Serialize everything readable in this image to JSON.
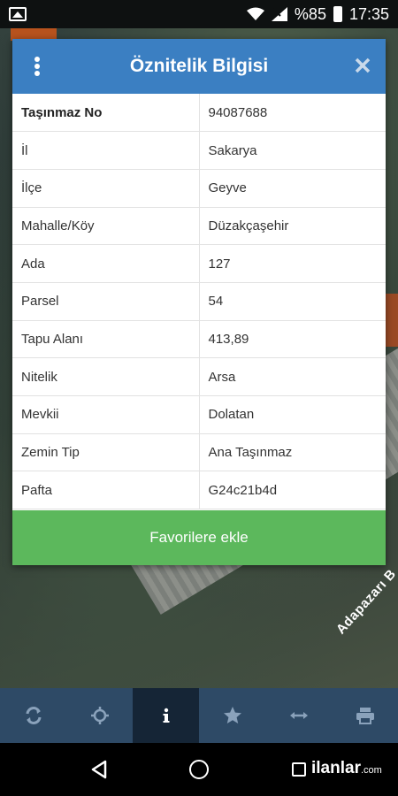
{
  "status_bar": {
    "battery": "%85",
    "time": "17:35"
  },
  "map": {
    "road_label": "Adapazarı B"
  },
  "dialog": {
    "title": "Öznitelik Bilgisi",
    "rows": [
      {
        "key": "Taşınmaz No",
        "value": "94087688"
      },
      {
        "key": "İl",
        "value": "Sakarya"
      },
      {
        "key": "İlçe",
        "value": "Geyve"
      },
      {
        "key": "Mahalle/Köy",
        "value": "Düzakçaşehir"
      },
      {
        "key": "Ada",
        "value": "127"
      },
      {
        "key": "Parsel",
        "value": "54"
      },
      {
        "key": "Tapu Alanı",
        "value": "413,89"
      },
      {
        "key": "Nitelik",
        "value": "Arsa"
      },
      {
        "key": "Mevkii",
        "value": "Dolatan"
      },
      {
        "key": "Zemin Tip",
        "value": "Ana Taşınmaz"
      },
      {
        "key": "Pafta",
        "value": "G24c21b4d"
      }
    ],
    "favorite_button": "Favorilere ekle"
  },
  "toolbar": {
    "icons": [
      "refresh-icon",
      "crosshair-icon",
      "info-icon",
      "star-icon",
      "measure-icon",
      "print-icon"
    ],
    "active": "info-icon"
  },
  "watermark": {
    "brand": "ilanlar",
    "suffix": ".com"
  }
}
